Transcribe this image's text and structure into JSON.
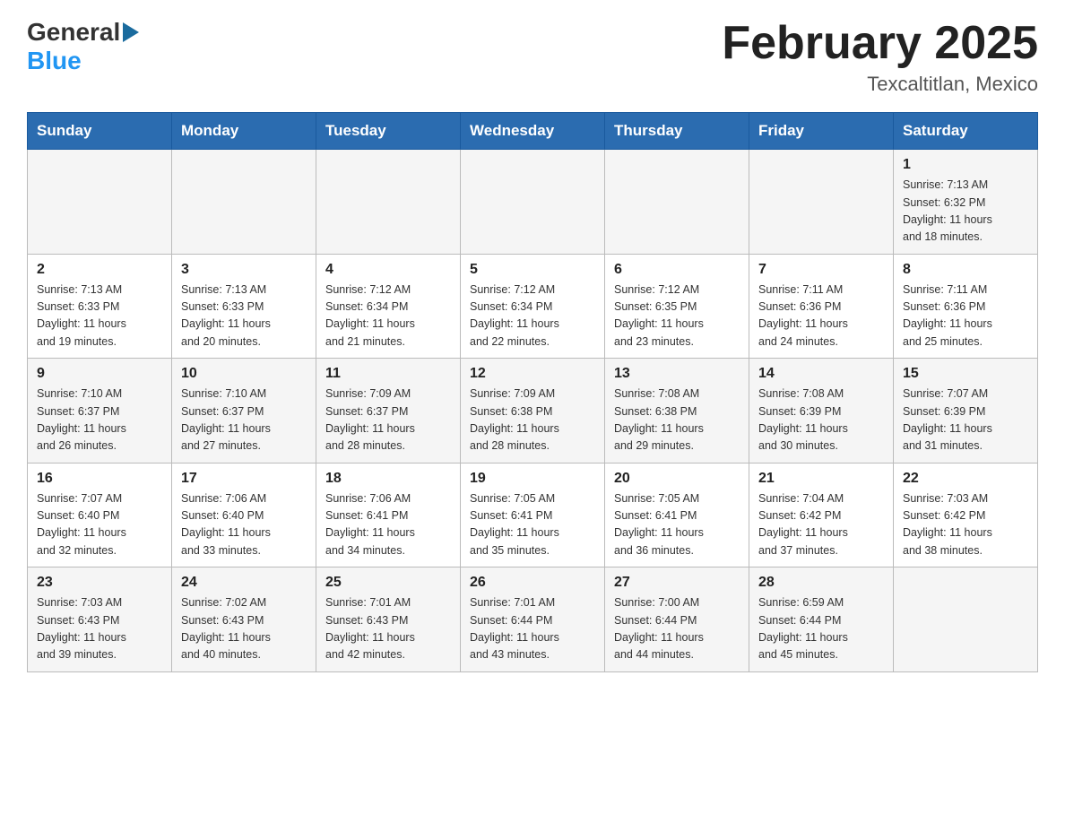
{
  "header": {
    "logo_general": "General",
    "logo_blue": "Blue",
    "month_title": "February 2025",
    "location": "Texcaltitlan, Mexico"
  },
  "days_of_week": [
    "Sunday",
    "Monday",
    "Tuesday",
    "Wednesday",
    "Thursday",
    "Friday",
    "Saturday"
  ],
  "weeks": [
    {
      "days": [
        {
          "number": "",
          "info": ""
        },
        {
          "number": "",
          "info": ""
        },
        {
          "number": "",
          "info": ""
        },
        {
          "number": "",
          "info": ""
        },
        {
          "number": "",
          "info": ""
        },
        {
          "number": "",
          "info": ""
        },
        {
          "number": "1",
          "info": "Sunrise: 7:13 AM\nSunset: 6:32 PM\nDaylight: 11 hours\nand 18 minutes."
        }
      ]
    },
    {
      "days": [
        {
          "number": "2",
          "info": "Sunrise: 7:13 AM\nSunset: 6:33 PM\nDaylight: 11 hours\nand 19 minutes."
        },
        {
          "number": "3",
          "info": "Sunrise: 7:13 AM\nSunset: 6:33 PM\nDaylight: 11 hours\nand 20 minutes."
        },
        {
          "number": "4",
          "info": "Sunrise: 7:12 AM\nSunset: 6:34 PM\nDaylight: 11 hours\nand 21 minutes."
        },
        {
          "number": "5",
          "info": "Sunrise: 7:12 AM\nSunset: 6:34 PM\nDaylight: 11 hours\nand 22 minutes."
        },
        {
          "number": "6",
          "info": "Sunrise: 7:12 AM\nSunset: 6:35 PM\nDaylight: 11 hours\nand 23 minutes."
        },
        {
          "number": "7",
          "info": "Sunrise: 7:11 AM\nSunset: 6:36 PM\nDaylight: 11 hours\nand 24 minutes."
        },
        {
          "number": "8",
          "info": "Sunrise: 7:11 AM\nSunset: 6:36 PM\nDaylight: 11 hours\nand 25 minutes."
        }
      ]
    },
    {
      "days": [
        {
          "number": "9",
          "info": "Sunrise: 7:10 AM\nSunset: 6:37 PM\nDaylight: 11 hours\nand 26 minutes."
        },
        {
          "number": "10",
          "info": "Sunrise: 7:10 AM\nSunset: 6:37 PM\nDaylight: 11 hours\nand 27 minutes."
        },
        {
          "number": "11",
          "info": "Sunrise: 7:09 AM\nSunset: 6:37 PM\nDaylight: 11 hours\nand 28 minutes."
        },
        {
          "number": "12",
          "info": "Sunrise: 7:09 AM\nSunset: 6:38 PM\nDaylight: 11 hours\nand 28 minutes."
        },
        {
          "number": "13",
          "info": "Sunrise: 7:08 AM\nSunset: 6:38 PM\nDaylight: 11 hours\nand 29 minutes."
        },
        {
          "number": "14",
          "info": "Sunrise: 7:08 AM\nSunset: 6:39 PM\nDaylight: 11 hours\nand 30 minutes."
        },
        {
          "number": "15",
          "info": "Sunrise: 7:07 AM\nSunset: 6:39 PM\nDaylight: 11 hours\nand 31 minutes."
        }
      ]
    },
    {
      "days": [
        {
          "number": "16",
          "info": "Sunrise: 7:07 AM\nSunset: 6:40 PM\nDaylight: 11 hours\nand 32 minutes."
        },
        {
          "number": "17",
          "info": "Sunrise: 7:06 AM\nSunset: 6:40 PM\nDaylight: 11 hours\nand 33 minutes."
        },
        {
          "number": "18",
          "info": "Sunrise: 7:06 AM\nSunset: 6:41 PM\nDaylight: 11 hours\nand 34 minutes."
        },
        {
          "number": "19",
          "info": "Sunrise: 7:05 AM\nSunset: 6:41 PM\nDaylight: 11 hours\nand 35 minutes."
        },
        {
          "number": "20",
          "info": "Sunrise: 7:05 AM\nSunset: 6:41 PM\nDaylight: 11 hours\nand 36 minutes."
        },
        {
          "number": "21",
          "info": "Sunrise: 7:04 AM\nSunset: 6:42 PM\nDaylight: 11 hours\nand 37 minutes."
        },
        {
          "number": "22",
          "info": "Sunrise: 7:03 AM\nSunset: 6:42 PM\nDaylight: 11 hours\nand 38 minutes."
        }
      ]
    },
    {
      "days": [
        {
          "number": "23",
          "info": "Sunrise: 7:03 AM\nSunset: 6:43 PM\nDaylight: 11 hours\nand 39 minutes."
        },
        {
          "number": "24",
          "info": "Sunrise: 7:02 AM\nSunset: 6:43 PM\nDaylight: 11 hours\nand 40 minutes."
        },
        {
          "number": "25",
          "info": "Sunrise: 7:01 AM\nSunset: 6:43 PM\nDaylight: 11 hours\nand 42 minutes."
        },
        {
          "number": "26",
          "info": "Sunrise: 7:01 AM\nSunset: 6:44 PM\nDaylight: 11 hours\nand 43 minutes."
        },
        {
          "number": "27",
          "info": "Sunrise: 7:00 AM\nSunset: 6:44 PM\nDaylight: 11 hours\nand 44 minutes."
        },
        {
          "number": "28",
          "info": "Sunrise: 6:59 AM\nSunset: 6:44 PM\nDaylight: 11 hours\nand 45 minutes."
        },
        {
          "number": "",
          "info": ""
        }
      ]
    }
  ]
}
